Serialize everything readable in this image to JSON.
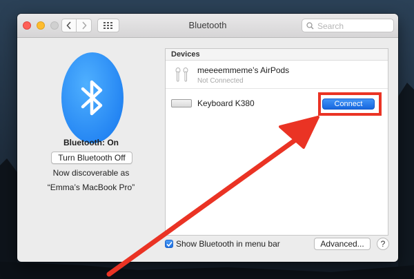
{
  "window": {
    "title": "Bluetooth",
    "search_placeholder": "Search"
  },
  "bluetooth": {
    "status": "Bluetooth: On",
    "toggle_label": "Turn Bluetooth Off",
    "discoverable_line1": "Now discoverable as",
    "discoverable_line2": "“Emma’s MacBook Pro”"
  },
  "devices": {
    "header": "Devices",
    "items": [
      {
        "name": "meeeemmeme’s AirPods",
        "status": "Not Connected",
        "icon": "airpods-icon"
      },
      {
        "name": "Keyboard K380",
        "action": "Connect",
        "icon": "keyboard-icon"
      }
    ]
  },
  "footer": {
    "show_in_menu_bar": "Show Bluetooth in menu bar",
    "show_in_menu_bar_checked": true,
    "advanced_label": "Advanced...",
    "help_label": "?"
  },
  "colors": {
    "bluetooth_blue": "#1475ee",
    "annotation_red": "#ea3324",
    "connect_blue": "#1767de"
  }
}
